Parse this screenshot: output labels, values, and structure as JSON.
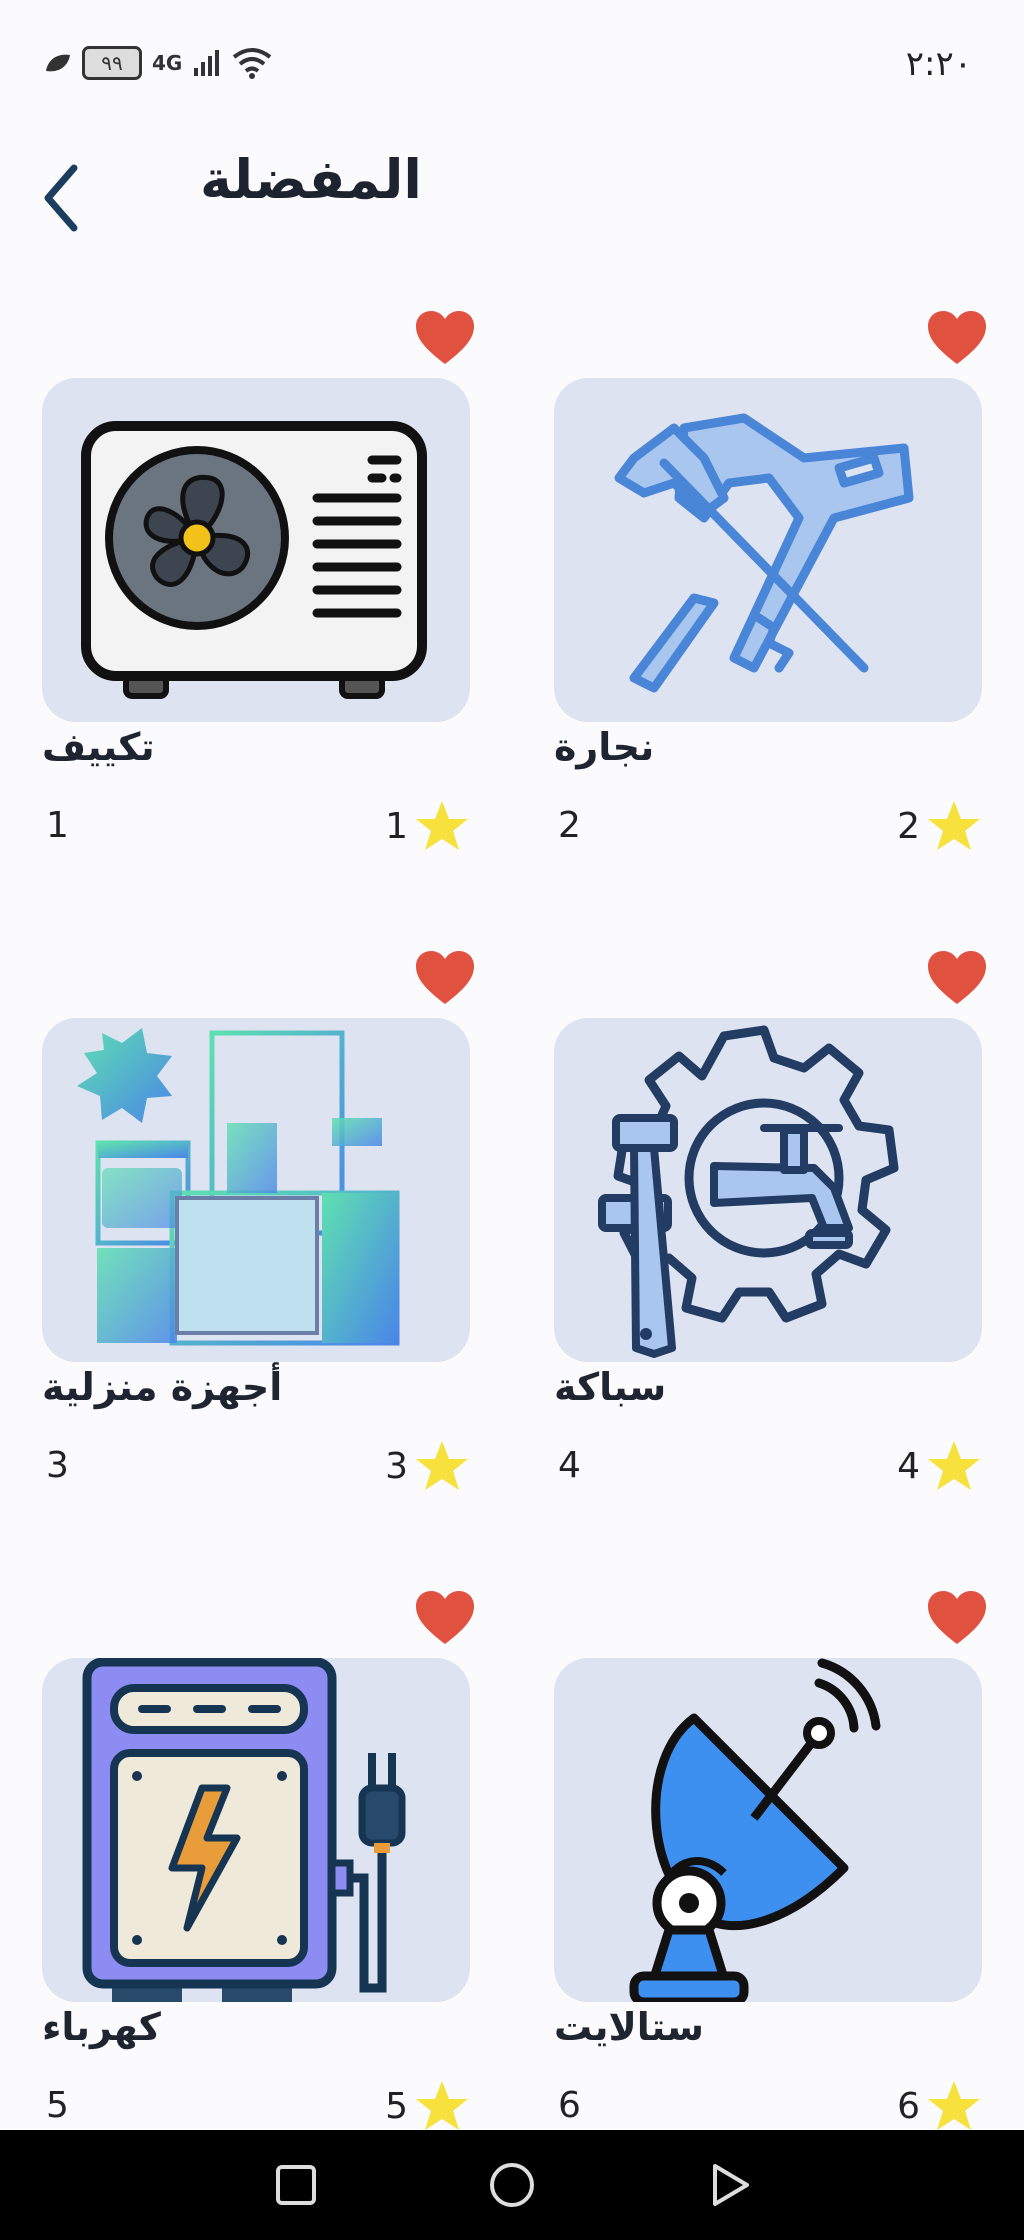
{
  "status_bar": {
    "time": "٢:٢٠",
    "battery": "٩٩",
    "network": "4G"
  },
  "header": {
    "title": "المفضلة",
    "back_icon": "chevron-left-icon"
  },
  "colors": {
    "heart": "#e0513f",
    "star": "#f6e13d",
    "thumb_bg": "#dde3f1",
    "title_text": "#1d2430"
  },
  "favorites": [
    {
      "title": "نجارة",
      "count": "2",
      "rating": "2",
      "icon": "carpentry-tools-icon"
    },
    {
      "title": "تكييف",
      "count": "1",
      "rating": "1",
      "icon": "air-conditioner-icon"
    },
    {
      "title": "سباكة",
      "count": "4",
      "rating": "4",
      "icon": "plumbing-gear-icon"
    },
    {
      "title": "أجهزة منزلية",
      "count": "3",
      "rating": "3",
      "icon": "home-appliances-icon"
    },
    {
      "title": "ستالايت",
      "count": "6",
      "rating": "6",
      "icon": "satellite-dish-icon"
    },
    {
      "title": "كهرباء",
      "count": "5",
      "rating": "5",
      "icon": "electricity-generator-icon"
    }
  ],
  "nav": {
    "recents_icon": "square-icon",
    "home_icon": "circle-icon",
    "back_icon": "triangle-back-icon"
  }
}
